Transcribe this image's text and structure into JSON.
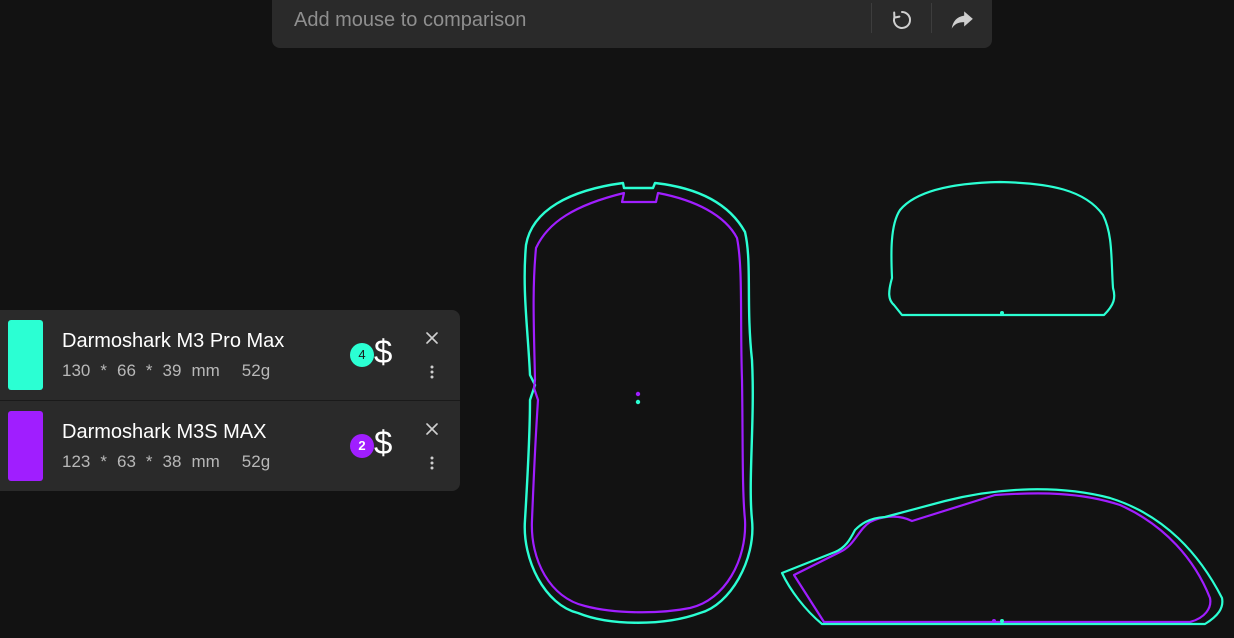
{
  "search": {
    "placeholder": "Add mouse to comparison",
    "reset_icon": "refresh-icon",
    "share_icon": "share-icon"
  },
  "mice": [
    {
      "name": "Darmoshark M3 Pro Max",
      "color": "#2bffd3",
      "length": "130",
      "width": "66",
      "height": "39",
      "unit": "mm",
      "weight": "52g",
      "badge": "4",
      "price_symbol": "$",
      "separator": "*"
    },
    {
      "name": "Darmoshark M3S MAX",
      "color": "#a01eff",
      "length": "123",
      "width": "63",
      "height": "38",
      "unit": "mm",
      "weight": "52g",
      "badge": "2",
      "price_symbol": "$",
      "separator": "*"
    }
  ],
  "colors": {
    "background": "#121212",
    "panel": "#2a2a2a",
    "mouse_a": "#2bffd3",
    "mouse_b": "#a01eff"
  }
}
